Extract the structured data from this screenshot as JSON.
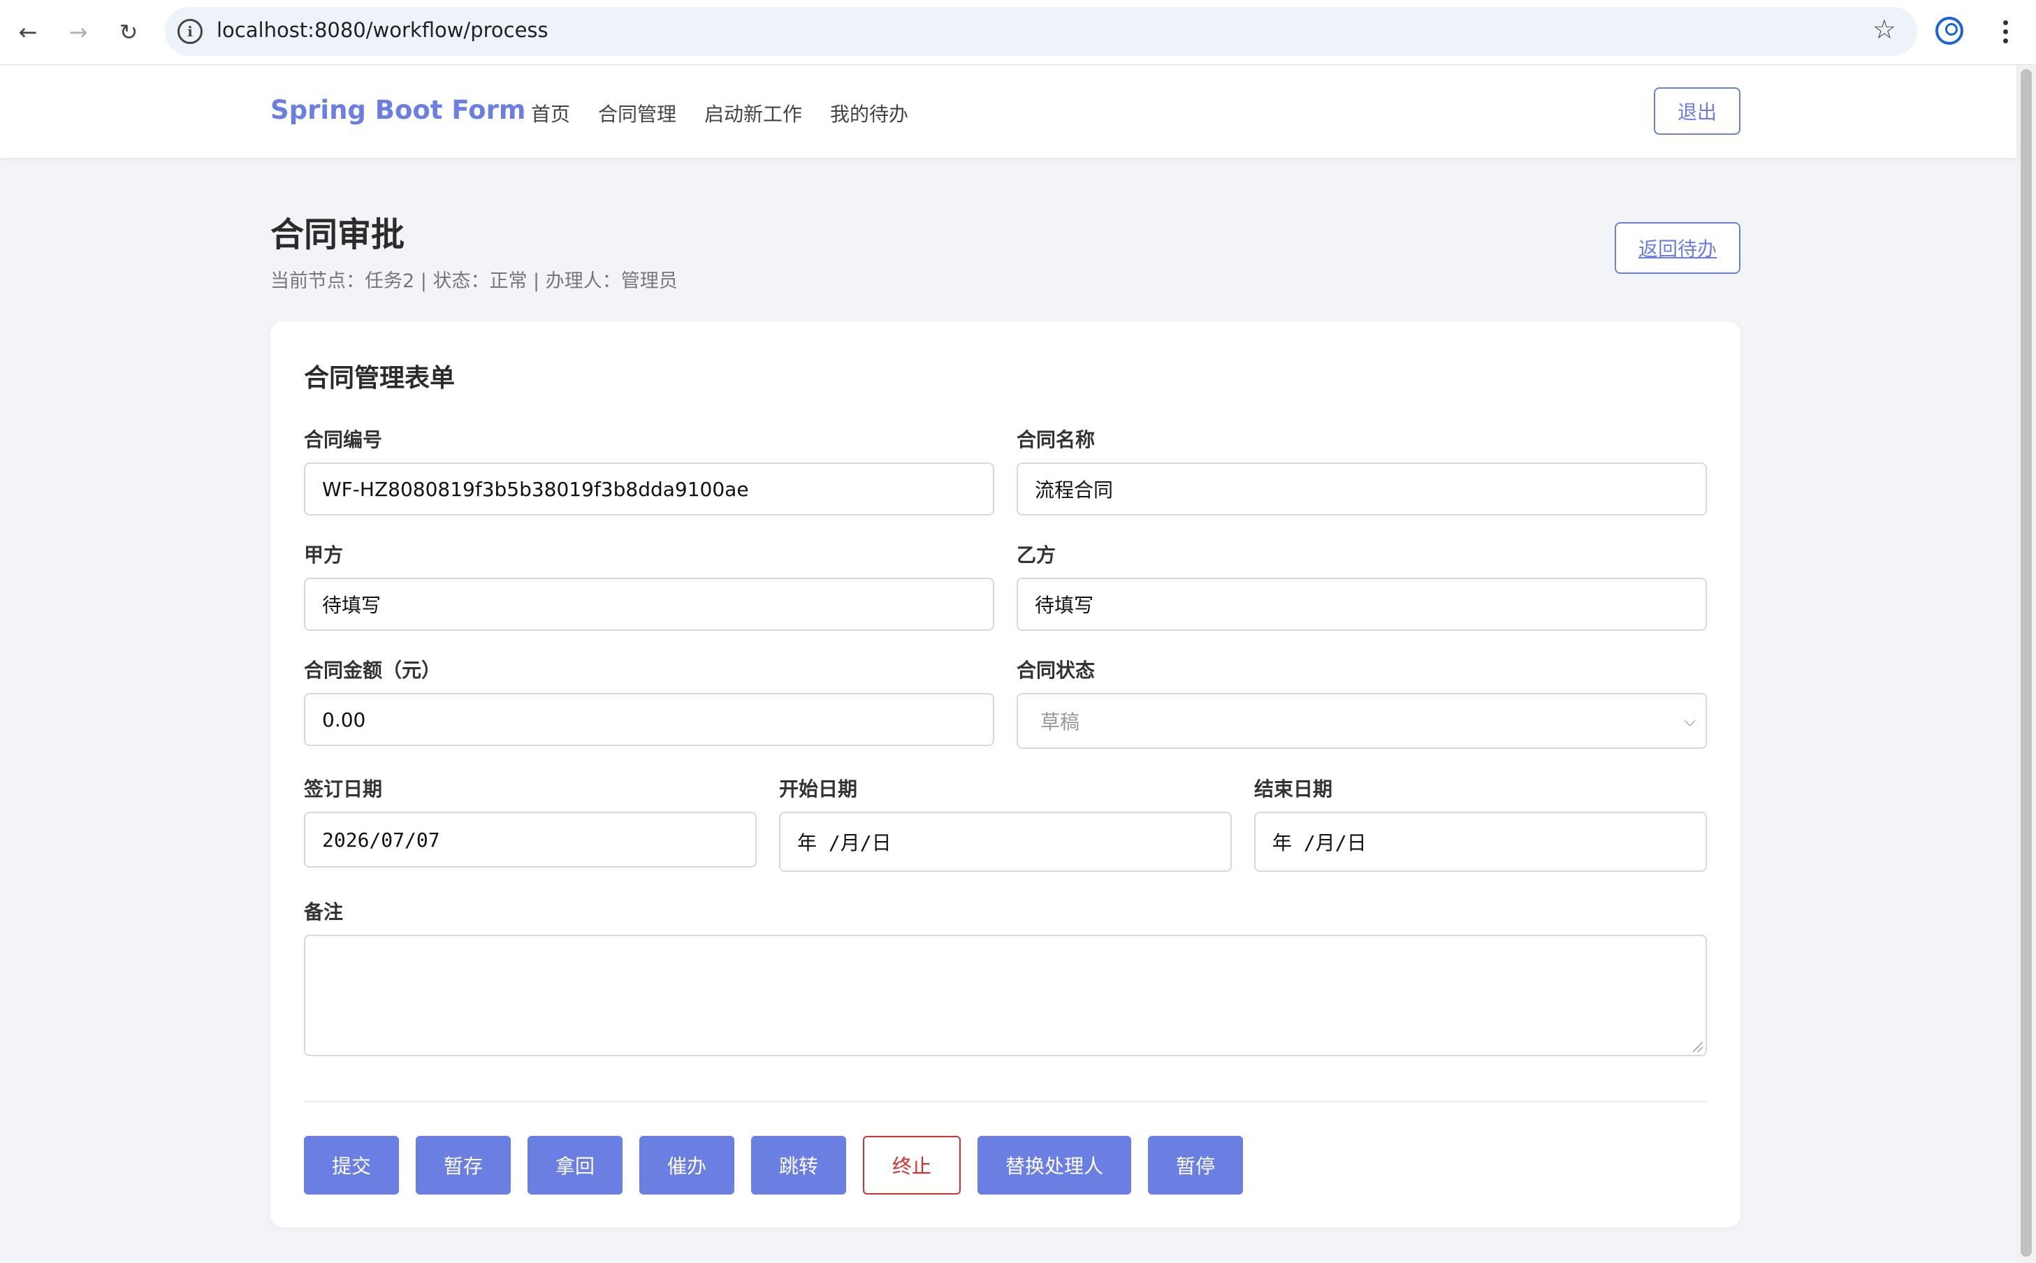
{
  "browser": {
    "url": "localhost:8080/workflow/process",
    "back_icon": "arrow-left-icon",
    "forward_icon": "arrow-right-icon",
    "reload_icon": "reload-icon",
    "info_glyph": "i",
    "bookmark_icon": "star-icon",
    "profile_icon": "profile-icon",
    "menu_icon": "kebab-menu-icon"
  },
  "header": {
    "brand": "Spring Boot Form",
    "nav": [
      "首页",
      "合同管理",
      "启动新工作",
      "我的待办"
    ],
    "logout_label": "退出"
  },
  "page": {
    "title": "合同审批",
    "subtitle": "当前节点：任务2 | 状态：正常 | 办理人：管理员",
    "back_label": "返回待办"
  },
  "form": {
    "title": "合同管理表单",
    "contract_no": {
      "label": "合同编号",
      "value": "WF-HZ8080819f3b5b38019f3b8dda9100ae"
    },
    "contract_name": {
      "label": "合同名称",
      "value": "流程合同"
    },
    "party_a": {
      "label": "甲方",
      "value": "待填写"
    },
    "party_b": {
      "label": "乙方",
      "value": "待填写"
    },
    "amount": {
      "label": "合同金额（元）",
      "value": "0.00"
    },
    "status": {
      "label": "合同状态",
      "value": "草稿"
    },
    "sign_date": {
      "label": "签订日期",
      "value": "2026/07/07"
    },
    "start_date": {
      "label": "开始日期",
      "placeholder": " 年  /月/日"
    },
    "end_date": {
      "label": "结束日期",
      "placeholder": " 年  /月/日"
    },
    "remark": {
      "label": "备注",
      "value": ""
    }
  },
  "actions": {
    "submit": "提交",
    "save_draft": "暂存",
    "retrieve": "拿回",
    "urge": "催办",
    "jump": "跳转",
    "terminate": "终止",
    "reassign": "替换处理人",
    "suspend": "暂停"
  },
  "colors": {
    "accent": "#6b7fe3",
    "danger": "#d32f2f",
    "background": "#f3f4f8"
  }
}
